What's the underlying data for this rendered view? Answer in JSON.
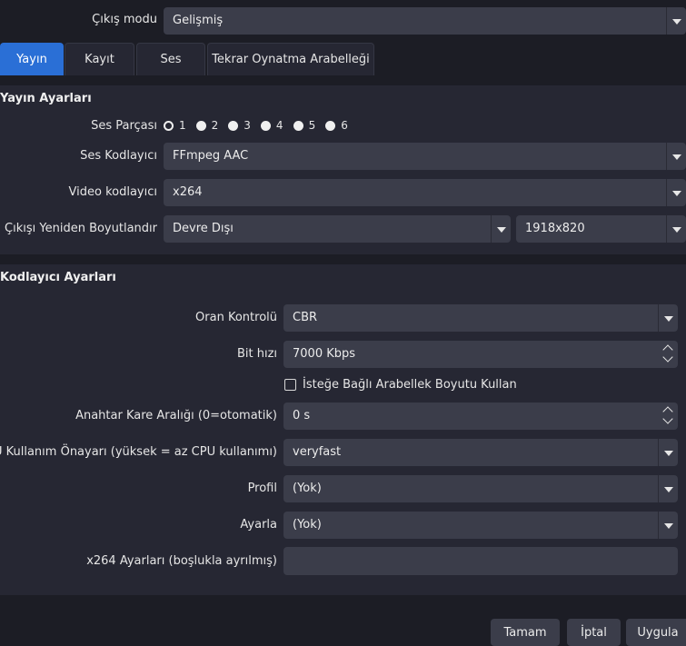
{
  "output_mode": {
    "label": "Çıkış modu",
    "value": "Gelişmiş"
  },
  "tabs": [
    {
      "label": "Yayın",
      "active": true
    },
    {
      "label": "Kayıt",
      "active": false
    },
    {
      "label": "Ses",
      "active": false
    },
    {
      "label": "Tekrar Oynatma Arabelleği",
      "active": false
    }
  ],
  "stream_settings": {
    "title": "Yayın Ayarları",
    "audio_track": {
      "label": "Ses Parçası",
      "options": [
        "1",
        "2",
        "3",
        "4",
        "5",
        "6"
      ],
      "selected": "1"
    },
    "audio_encoder": {
      "label": "Ses Kodlayıcı",
      "value": "FFmpeg AAC"
    },
    "video_encoder": {
      "label": "Video kodlayıcı",
      "value": "x264"
    },
    "rescale": {
      "label": "Çıkışı Yeniden Boyutlandır",
      "value": "Devre Dışı",
      "resolution": "1918x820"
    }
  },
  "encoder_settings": {
    "title": "Kodlayıcı Ayarları",
    "rate_control": {
      "label": "Oran Kontrolü",
      "value": "CBR"
    },
    "bitrate": {
      "label": "Bit hızı",
      "value": "7000 Kbps"
    },
    "custom_buffer": {
      "label": "İsteğe Bağlı Arabellek Boyutu Kullan",
      "checked": false
    },
    "keyframe": {
      "label": "Anahtar Kare Aralığı (0=otomatik)",
      "value": "0 s"
    },
    "cpu_preset": {
      "label": "CPU Kullanım Önayarı (yüksek = az CPU kullanımı)",
      "value": "veryfast"
    },
    "profile": {
      "label": "Profil",
      "value": "(Yok)"
    },
    "tune": {
      "label": "Ayarla",
      "value": "(Yok)"
    },
    "x264_opts": {
      "label": "x264 Ayarları (boşlukla ayrılmış)",
      "value": ""
    }
  },
  "buttons": {
    "ok": "Tamam",
    "cancel": "İptal",
    "apply": "Uygula"
  },
  "colors": {
    "background": "#1c1d25",
    "panel": "#262733",
    "input": "#3b3d4a",
    "accent": "#2a6fd6"
  }
}
